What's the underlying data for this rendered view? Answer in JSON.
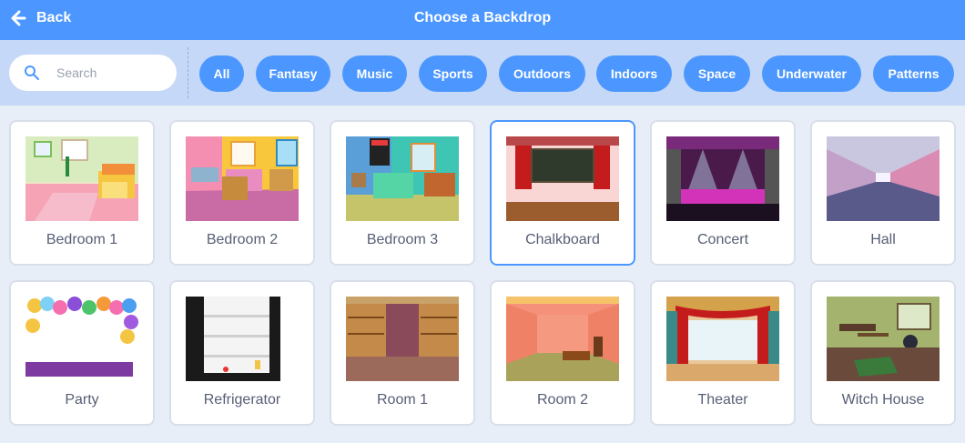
{
  "header": {
    "back_label": "Back",
    "title": "Choose a Backdrop"
  },
  "search": {
    "placeholder": "Search"
  },
  "tags": [
    {
      "label": "All",
      "active": false
    },
    {
      "label": "Fantasy",
      "active": false
    },
    {
      "label": "Music",
      "active": false
    },
    {
      "label": "Sports",
      "active": false
    },
    {
      "label": "Outdoors",
      "active": false
    },
    {
      "label": "Indoors",
      "active": true
    },
    {
      "label": "Space",
      "active": false
    },
    {
      "label": "Underwater",
      "active": false
    },
    {
      "label": "Patterns",
      "active": false
    }
  ],
  "colors": {
    "header": "#4c97ff",
    "filterbar": "#c5d8f7",
    "active_tag": "#ff8c1a",
    "tag": "#4c97ff",
    "label_text": "#575e75"
  },
  "backdrops": [
    {
      "name": "Bedroom 1",
      "selected": false
    },
    {
      "name": "Bedroom 2",
      "selected": false
    },
    {
      "name": "Bedroom 3",
      "selected": false
    },
    {
      "name": "Chalkboard",
      "selected": true
    },
    {
      "name": "Concert",
      "selected": false
    },
    {
      "name": "Hall",
      "selected": false
    },
    {
      "name": "Party",
      "selected": false
    },
    {
      "name": "Refrigerator",
      "selected": false
    },
    {
      "name": "Room 1",
      "selected": false
    },
    {
      "name": "Room 2",
      "selected": false
    },
    {
      "name": "Theater",
      "selected": false
    },
    {
      "name": "Witch House",
      "selected": false
    }
  ]
}
